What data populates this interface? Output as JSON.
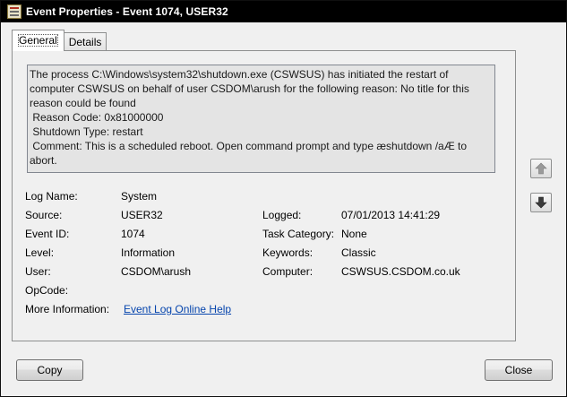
{
  "window": {
    "title": "Event Properties - Event 1074, USER32",
    "icon": "event-viewer-icon"
  },
  "tabs": [
    {
      "label": "General",
      "active": true
    },
    {
      "label": "Details",
      "active": false
    }
  ],
  "general": {
    "message": "The process C:\\Windows\\system32\\shutdown.exe (CSWSUS) has initiated the restart of computer CSWSUS on behalf of user CSDOM\\arush for the following reason: No title for this reason could be found\n Reason Code: 0x81000000\n Shutdown Type: restart\n Comment: This is a scheduled reboot. Open command prompt and type æshutdown /aÆ to abort.",
    "fields": {
      "log_name_label": "Log Name:",
      "log_name": "System",
      "source_label": "Source:",
      "source": "USER32",
      "logged_label": "Logged:",
      "logged": "07/01/2013 14:41:29",
      "event_id_label": "Event ID:",
      "event_id": "1074",
      "task_category_label": "Task Category:",
      "task_category": "None",
      "level_label": "Level:",
      "level": "Information",
      "keywords_label": "Keywords:",
      "keywords": "Classic",
      "user_label": "User:",
      "user": "CSDOM\\arush",
      "computer_label": "Computer:",
      "computer": "CSWSUS.CSDOM.co.uk",
      "opcode_label": "OpCode:",
      "opcode": "",
      "more_info_label": "More Information:",
      "more_info_link": "Event Log Online Help"
    }
  },
  "navigation": {
    "up_icon": "arrow-up-icon",
    "down_icon": "arrow-down-icon"
  },
  "buttons": {
    "copy": "Copy",
    "close": "Close"
  }
}
